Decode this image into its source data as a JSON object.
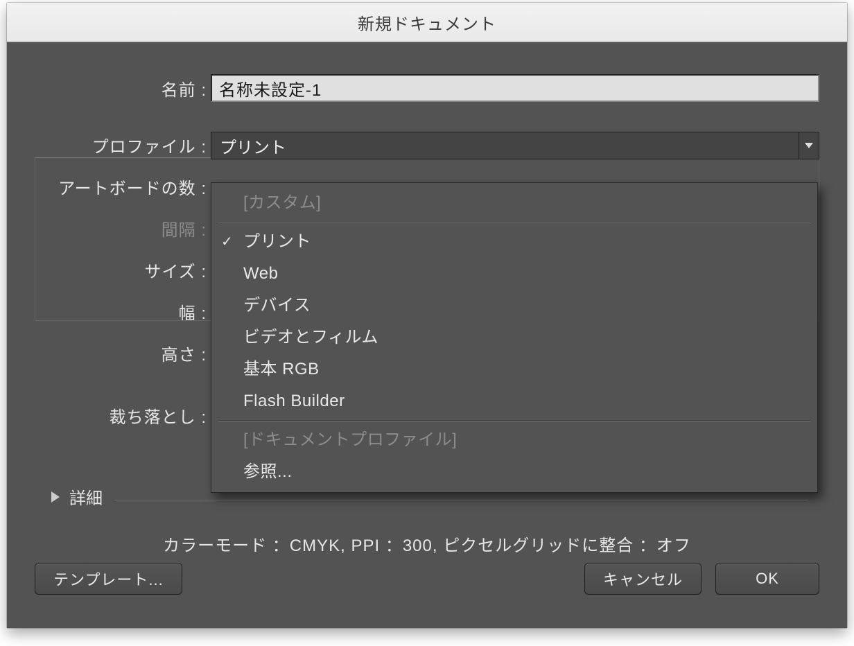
{
  "title": "新規ドキュメント",
  "labels": {
    "name": "名前 :",
    "profile": "プロファイル :",
    "artboards": "アートボードの数 :",
    "spacing": "間隔 :",
    "size": "サイズ :",
    "width": "幅 :",
    "height": "高さ :",
    "bleed": "裁ち落とし :",
    "details": "詳細"
  },
  "name_value": "名称未設定-1",
  "profile_selected": "プリント",
  "dropdown": {
    "custom": "[カスタム]",
    "items": [
      "プリント",
      "Web",
      "デバイス",
      "ビデオとフィルム",
      "基本 RGB",
      "Flash Builder"
    ],
    "doc_profile_header": "[ドキュメントプロファイル]",
    "browse": "参照...",
    "selected_index": 0
  },
  "summary": "カラーモード ：CMYK, PPI ：300, ピクセルグリッドに整合 ：オフ",
  "buttons": {
    "template": "テンプレート...",
    "cancel": "キャンセル",
    "ok": "OK"
  }
}
